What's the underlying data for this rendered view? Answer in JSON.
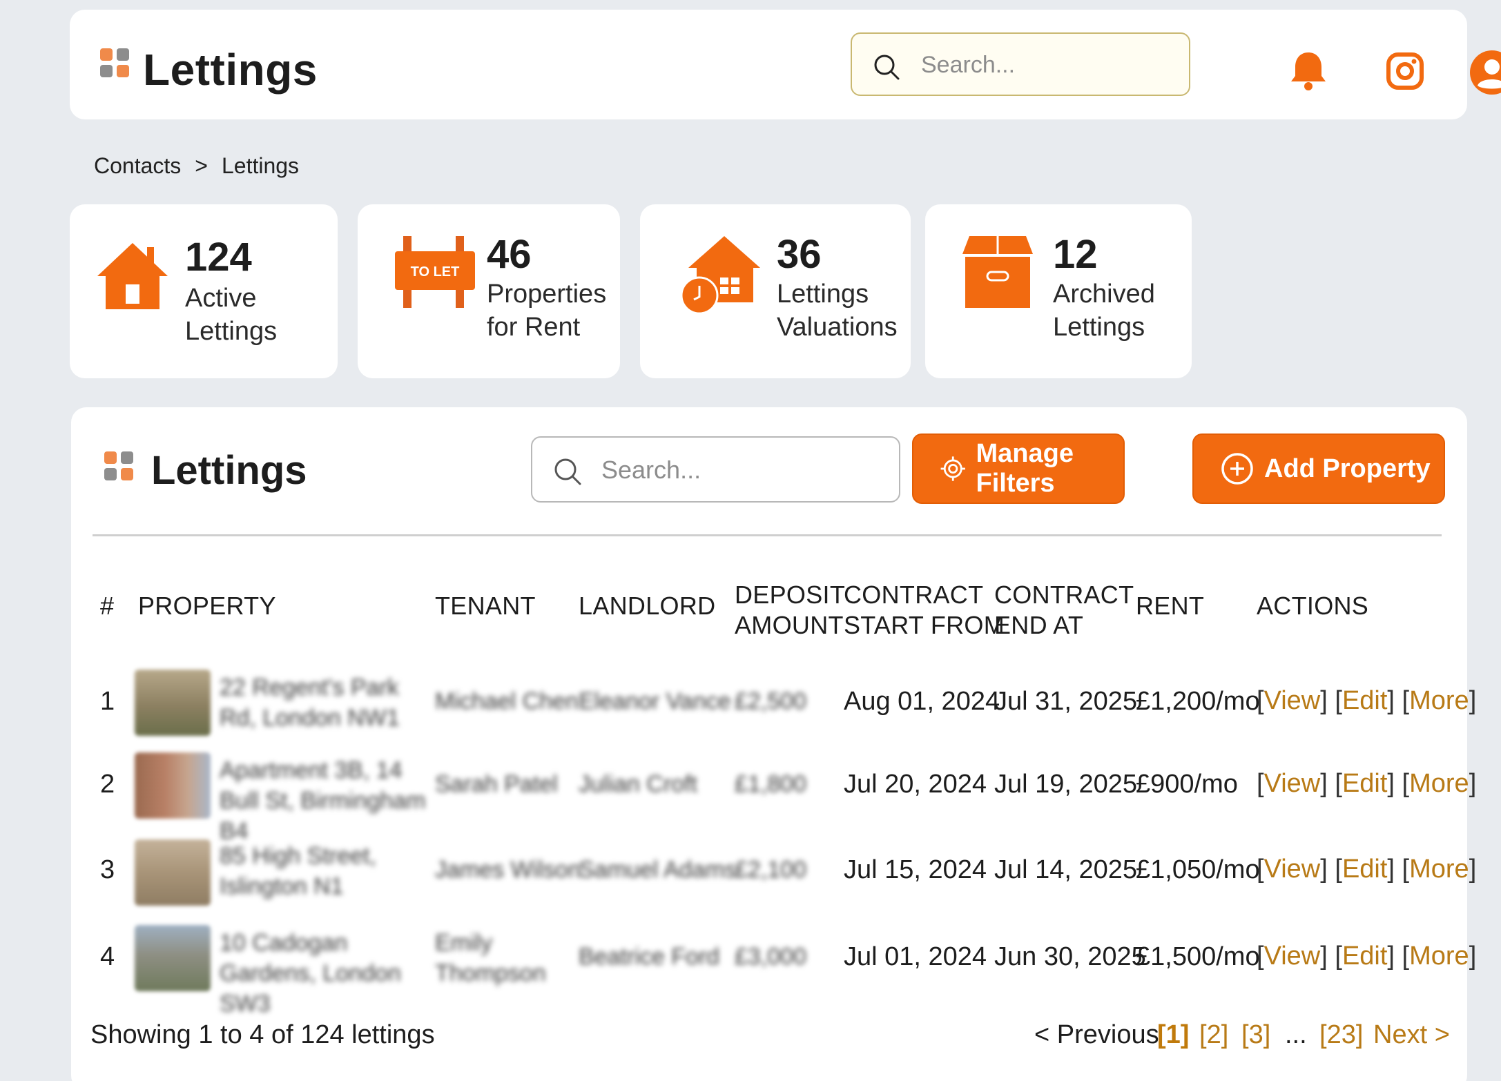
{
  "header": {
    "title": "Lettings",
    "search_placeholder": "Search..."
  },
  "breadcrumb": {
    "items": [
      "Contacts",
      "Lettings"
    ],
    "separator": ">"
  },
  "stats": [
    {
      "value": "124",
      "label": "Active\nLettings",
      "icon": "house-icon"
    },
    {
      "value": "46",
      "label": "Properties\nfor Rent",
      "icon": "to-let-sign-icon",
      "sign_text": "TO LET"
    },
    {
      "value": "36",
      "label": "Lettings\nValuations",
      "icon": "house-clock-icon"
    },
    {
      "value": "12",
      "label": "Archived\nLettings",
      "icon": "archive-box-icon"
    }
  ],
  "panel": {
    "title": "Lettings",
    "search_placeholder": "Search...",
    "manage_filters_label": "Manage Filters",
    "add_property_label": "Add Property"
  },
  "table": {
    "columns": [
      "#",
      "PROPERTY",
      "TENANT",
      "LANDLORD",
      "DEPOSIT\nAMOUNT",
      "CONTRACT\nSTART FROM",
      "CONTRACT\nEND AT",
      "RENT",
      "ACTIONS"
    ],
    "rows": [
      {
        "num": "1",
        "property": "22 Regent's Park Rd, London NW1",
        "tenant": "Michael Chen",
        "landlord": "Eleanor Vance",
        "deposit": "£2,500",
        "start": "Aug 01, 2024",
        "end": "Jul 31, 2025",
        "rent": "£1,200/mo"
      },
      {
        "num": "2",
        "property": "Apartment 3B, 14 Bull St, Birmingham B4",
        "tenant": "Sarah Patel",
        "landlord": "Julian Croft",
        "deposit": "£1,800",
        "start": "Jul 20, 2024",
        "end": "Jul 19, 2025",
        "rent": "£900/mo"
      },
      {
        "num": "3",
        "property": "85 High Street, Islington N1",
        "tenant": "James Wilson",
        "landlord": "Samuel Adams",
        "deposit": "£2,100",
        "start": "Jul 15, 2024",
        "end": "Jul 14, 2025",
        "rent": "£1,050/mo"
      },
      {
        "num": "4",
        "property": "10 Cadogan Gardens, London SW3",
        "tenant": "Emily Thompson",
        "landlord": "Beatrice Ford",
        "deposit": "£3,000",
        "start": "Jul 01, 2024",
        "end": "Jun 30, 2025",
        "rent": "£1,500/mo"
      }
    ],
    "actions": {
      "view": "View",
      "edit": "Edit",
      "more": "More"
    }
  },
  "footer": {
    "showing": "Showing 1 to 4 of 124 lettings",
    "previous": "< Previous",
    "pages": [
      "1",
      "2",
      "3",
      "23"
    ],
    "ellipsis": "...",
    "next": "Next >"
  },
  "colors": {
    "accent": "#f26a10",
    "link": "#b87a16",
    "background": "#e8ebef"
  }
}
